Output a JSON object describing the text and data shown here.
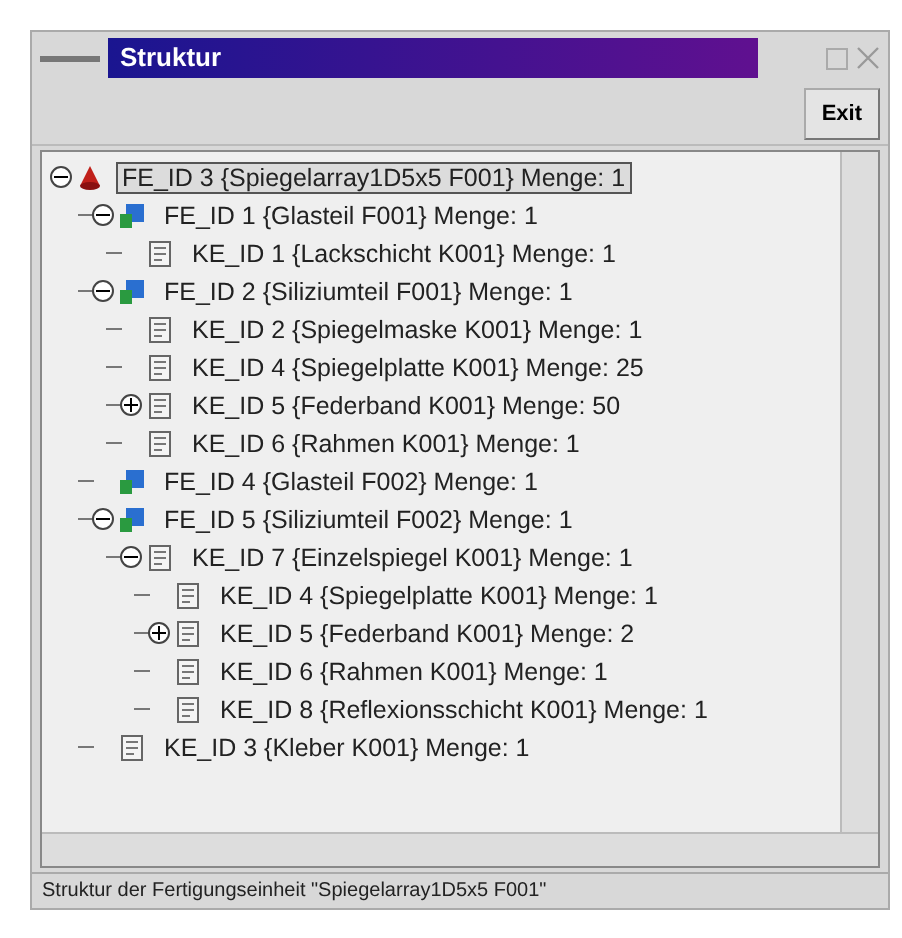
{
  "window": {
    "title": "Struktur"
  },
  "toolbar": {
    "buttons": [
      "Exit"
    ]
  },
  "tree": [
    {
      "kind": "assembly",
      "label": "FE_ID 3 {Spiegelarray1D5x5 F001} Menge: 1",
      "selected": true,
      "expanded": true,
      "children": [
        {
          "kind": "part",
          "label": "FE_ID 1 {Glasteil F001} Menge: 1",
          "selected": false,
          "expanded": true,
          "children": [
            {
              "kind": "component",
              "label": "KE_ID 1 {Lackschicht K001} Menge: 1",
              "selected": false
            }
          ]
        },
        {
          "kind": "part",
          "label": "FE_ID 2 {Siliziumteil F001} Menge: 1",
          "selected": false,
          "expanded": true,
          "children": [
            {
              "kind": "component",
              "label": "KE_ID 2 {Spiegelmaske K001} Menge: 1",
              "selected": false
            },
            {
              "kind": "component",
              "label": "KE_ID 4 {Spiegelplatte K001} Menge: 25",
              "selected": false
            },
            {
              "kind": "component",
              "label": "KE_ID 5 {Federband K001} Menge: 50",
              "selected": false,
              "expanded": false
            },
            {
              "kind": "component",
              "label": "KE_ID 6 {Rahmen K001} Menge: 1",
              "selected": false
            }
          ]
        },
        {
          "kind": "part",
          "label": "FE_ID 4 {Glasteil F002} Menge: 1",
          "selected": false
        },
        {
          "kind": "part",
          "label": "FE_ID 5 {Siliziumteil F002} Menge: 1",
          "selected": false,
          "expanded": true,
          "children": [
            {
              "kind": "component",
              "label": "KE_ID 7 {Einzelspiegel K001} Menge: 1",
              "selected": false,
              "expanded": true,
              "children": [
                {
                  "kind": "component",
                  "label": "KE_ID 4 {Spiegelplatte K001} Menge: 1",
                  "selected": false
                },
                {
                  "kind": "component",
                  "label": "KE_ID 5 {Federband K001} Menge: 2",
                  "selected": false,
                  "expanded": false
                },
                {
                  "kind": "component",
                  "label": "KE_ID 6 {Rahmen K001} Menge: 1",
                  "selected": false
                },
                {
                  "kind": "component",
                  "label": "KE_ID 8 {Reflexionsschicht K001} Menge: 1",
                  "selected": false
                }
              ]
            }
          ]
        },
        {
          "kind": "component",
          "label": "KE_ID 3 {Kleber K001} Menge: 1",
          "selected": false
        }
      ]
    }
  ],
  "status_bar": "Struktur der Fertigungseinheit \"Spiegelarray1D5x5 F001\""
}
